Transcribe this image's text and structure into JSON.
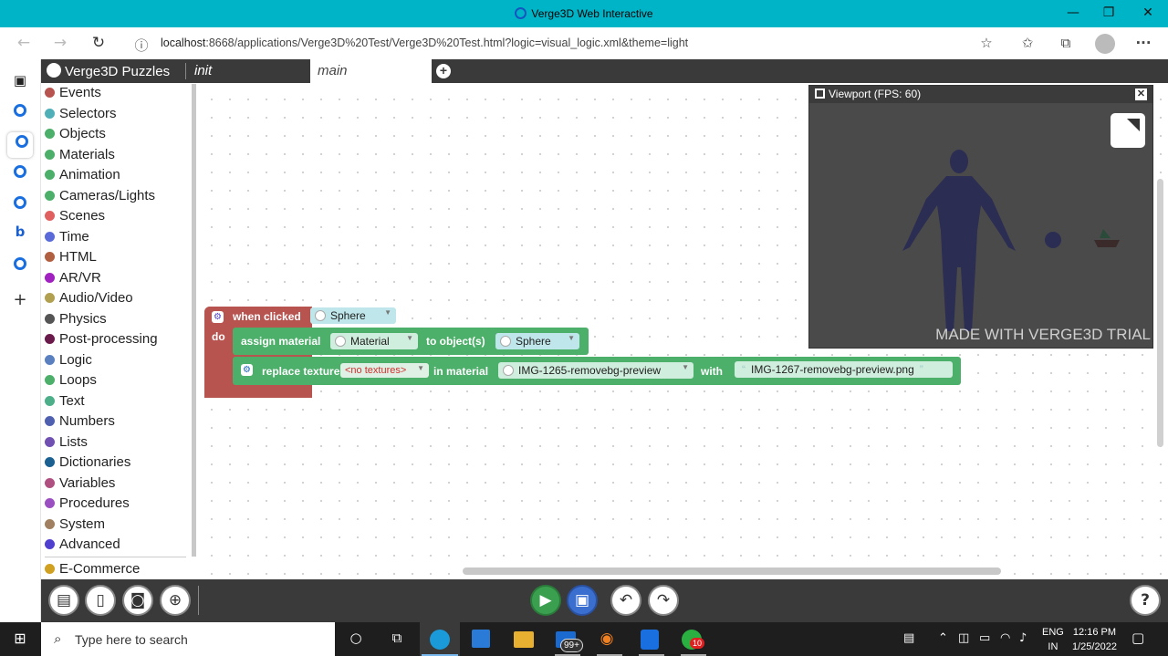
{
  "window": {
    "title": "Verge3D Web Interactive",
    "minimize": "—",
    "maximize": "❐",
    "close": "✕"
  },
  "browser": {
    "back": "←",
    "forward": "→",
    "reload": "↻",
    "info": "ⓘ",
    "url_host": "localhost",
    "url_rest": ":8668/applications/Verge3D%20Test/Verge3D%20Test.html?logic=visual_logic.xml&theme=light",
    "toolbar_icons": [
      "favorites-add-icon",
      "favorites-icon",
      "collections-icon",
      "profile-icon",
      "more-icon"
    ],
    "more": "···"
  },
  "edge_sidebar": [
    "tabs-icon",
    "verge3d-icon",
    "verge3d-icon",
    "verge3d-icon",
    "verge3d-icon",
    "bing-icon",
    "verge3d-icon",
    "add-icon"
  ],
  "puzzles": {
    "logo_text": "Verge3D Puzzles",
    "tabs": [
      {
        "label": "init"
      },
      {
        "label": "main"
      }
    ],
    "add_tab": "+"
  },
  "categories": [
    {
      "label": "Events",
      "color": "#b85450"
    },
    {
      "label": "Selectors",
      "color": "#4fb0b8"
    },
    {
      "label": "Objects",
      "color": "#4caf6a"
    },
    {
      "label": "Materials",
      "color": "#4caf6a"
    },
    {
      "label": "Animation",
      "color": "#4caf6a"
    },
    {
      "label": "Cameras/Lights",
      "color": "#4caf6a"
    },
    {
      "label": "Scenes",
      "color": "#e06060"
    },
    {
      "label": "Time",
      "color": "#5a6ad8"
    },
    {
      "label": "HTML",
      "color": "#b06040"
    },
    {
      "label": "AR/VR",
      "color": "#a020c0"
    },
    {
      "label": "Audio/Video",
      "color": "#b0a050"
    },
    {
      "label": "Physics",
      "color": "#555555"
    },
    {
      "label": "Post-processing",
      "color": "#6a1a4a"
    },
    {
      "label": "Logic",
      "color": "#5a80c0"
    },
    {
      "label": "Loops",
      "color": "#4caf6a"
    },
    {
      "label": "Text",
      "color": "#4caf8a"
    },
    {
      "label": "Numbers",
      "color": "#5060b0"
    },
    {
      "label": "Lists",
      "color": "#7050b0"
    },
    {
      "label": "Dictionaries",
      "color": "#1a6090"
    },
    {
      "label": "Variables",
      "color": "#b05080"
    },
    {
      "label": "Procedures",
      "color": "#9a50c0"
    },
    {
      "label": "System",
      "color": "#a08060"
    },
    {
      "label": "Advanced",
      "color": "#5040d0"
    },
    {
      "label": "E-Commerce",
      "color": "#d0a020"
    }
  ],
  "blocks": {
    "event": {
      "label": "when clicked",
      "target": "Sphere",
      "do": "do",
      "color": "#b85450"
    },
    "assign": {
      "label": "assign material",
      "material": "Material",
      "to_label": "to object(s)",
      "object": "Sphere",
      "color": "#4caf6a"
    },
    "replace": {
      "label": "replace texture",
      "texture": "<no textures>",
      "in_label": "in material",
      "material": "IMG-1265-removebg-preview",
      "with_label": "with",
      "file": "IMG-1267-removebg-preview.png",
      "quote_open": "“",
      "quote_close": "”"
    }
  },
  "viewport": {
    "title": "Viewport (FPS: 60)",
    "close": "✕",
    "trial_text": "MADE WITH VERGE3D TRIAL"
  },
  "toolbar": {
    "left_icons": [
      "file-icon",
      "save-panel-icon",
      "screenshot-icon",
      "target-icon"
    ],
    "run_icon": "run-icon",
    "save_icon": "save-icon",
    "undo_icon": "undo-icon",
    "redo_icon": "redo-icon",
    "help": "?"
  },
  "taskbar": {
    "search_placeholder": "Type here to search",
    "apps": [
      "cortana-icon",
      "task-view-icon",
      "edge-icon",
      "store-icon",
      "explorer-icon",
      "mail-icon",
      "blender-icon",
      "verge3d-icon",
      "whatsapp-icon"
    ],
    "mail_badge": "99+",
    "whatsapp_badge": "10",
    "lang_top": "ENG",
    "lang_bottom": "IN",
    "time": "12:16 PM",
    "date": "1/25/2022"
  }
}
